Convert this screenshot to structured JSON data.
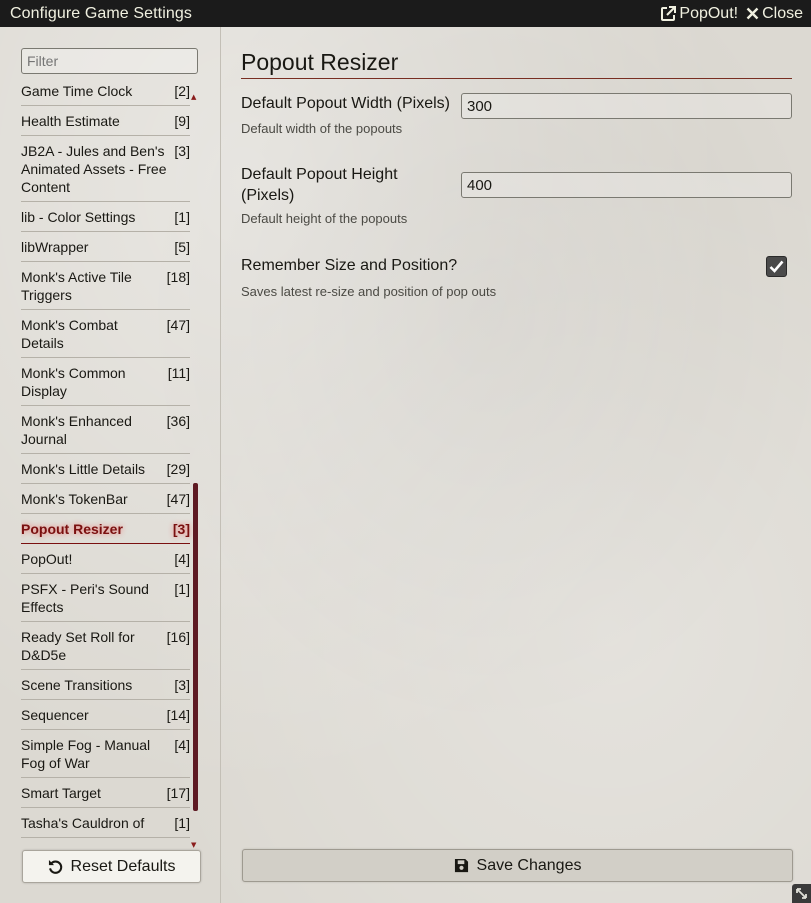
{
  "window": {
    "title": "Configure Game Settings",
    "popout_label": "PopOut!",
    "close_label": "Close"
  },
  "sidebar": {
    "filter_placeholder": "Filter",
    "categories": [
      {
        "name": "Game Time Clock",
        "count": "[2]"
      },
      {
        "name": "Health Estimate",
        "count": "[9]"
      },
      {
        "name": "JB2A - Jules and Ben's Animated Assets - Free Content",
        "count": "[3]"
      },
      {
        "name": "lib - Color Settings",
        "count": "[1]"
      },
      {
        "name": "libWrapper",
        "count": "[5]"
      },
      {
        "name": "Monk's Active Tile Triggers",
        "count": "[18]"
      },
      {
        "name": "Monk's Combat Details",
        "count": "[47]"
      },
      {
        "name": "Monk's Common Display",
        "count": "[11]"
      },
      {
        "name": "Monk's Enhanced Journal",
        "count": "[36]"
      },
      {
        "name": "Monk's Little Details",
        "count": "[29]"
      },
      {
        "name": "Monk's TokenBar",
        "count": "[47]"
      },
      {
        "name": "Popout Resizer",
        "count": "[3]",
        "active": true
      },
      {
        "name": "PopOut!",
        "count": "[4]"
      },
      {
        "name": "PSFX - Peri's Sound Effects",
        "count": "[1]"
      },
      {
        "name": "Ready Set Roll for D&D5e",
        "count": "[16]"
      },
      {
        "name": "Scene Transitions",
        "count": "[3]"
      },
      {
        "name": "Sequencer",
        "count": "[14]"
      },
      {
        "name": "Simple Fog - Manual Fog of War",
        "count": "[4]"
      },
      {
        "name": "Smart Target",
        "count": "[17]"
      },
      {
        "name": "Tasha's Cauldron of",
        "count": "[1]"
      }
    ],
    "reset_label": "Reset Defaults"
  },
  "main": {
    "section_title": "Popout Resizer",
    "settings": {
      "width": {
        "label": "Default Popout Width (Pixels)",
        "value": "300",
        "hint": "Default width of the popouts"
      },
      "height": {
        "label": "Default Popout Height (Pixels)",
        "value": "400",
        "hint": "Default height of the popouts"
      },
      "remember": {
        "label": "Remember Size and Position?",
        "hint": "Saves latest re-size and position of pop outs",
        "checked": true
      }
    },
    "save_label": "Save Changes"
  },
  "colors": {
    "titlebar": "#1b1b1b",
    "accent": "#782e22",
    "active_category": "#7a1010",
    "scrollbar": "#5e1a23"
  },
  "icons": {
    "popout": "external-link-icon",
    "close": "close-icon",
    "reset": "undo-icon",
    "save": "floppy-disk-icon",
    "resize": "resize-handle-icon"
  }
}
